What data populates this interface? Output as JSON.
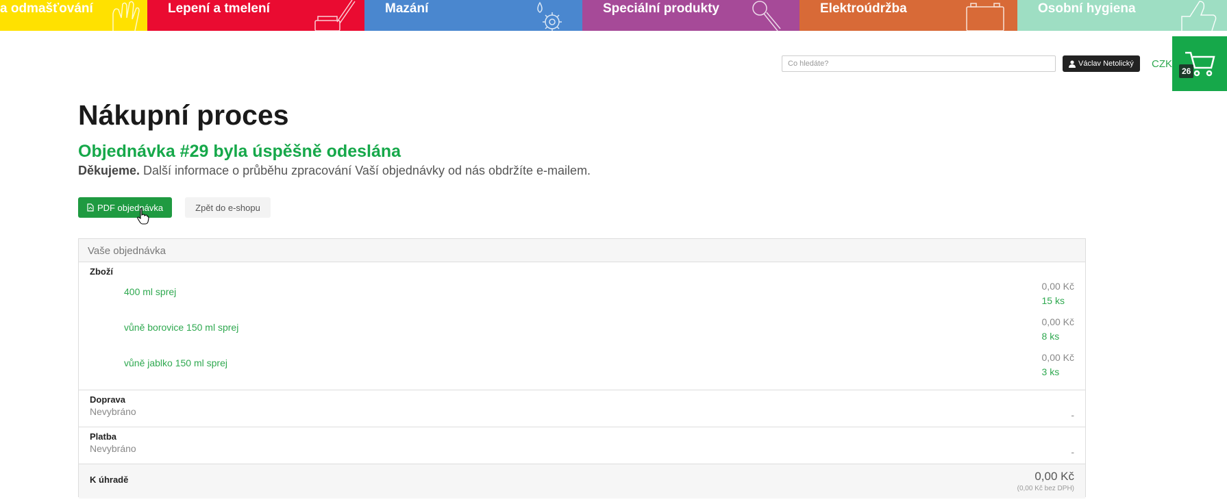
{
  "categories": [
    {
      "label": "a odmašťování",
      "color": "#ffe100"
    },
    {
      "label": "Lepení a tmelení",
      "color": "#ea0b31"
    },
    {
      "label": "Mazání",
      "color": "#4a87cf"
    },
    {
      "label": "Speciální produkty",
      "color": "#a64a98"
    },
    {
      "label": "Elektroúdržba",
      "color": "#d86a37"
    },
    {
      "label": "Osobní hygiena",
      "color": "#9edec3"
    }
  ],
  "header": {
    "search_placeholder": "Co hledáte?",
    "user_name": "Václav Netolický",
    "currency": "CZK",
    "cart_count": "26"
  },
  "main": {
    "title": "Nákupní proces",
    "success": "Objednávka #29 byla úspěšně odeslána",
    "thanks_bold": "Děkujeme.",
    "thanks_text": " Další informace o průběhu zpracování Vaší objednávky od nás obdržíte e-mailem.",
    "pdf_label": "PDF objednávka",
    "back_label": "Zpět do e-shopu"
  },
  "order": {
    "heading": "Vaše objednávka",
    "goods_label": "Zboží",
    "items": [
      {
        "name": "400 ml sprej",
        "price": "0,00 Kč",
        "qty": "15 ks"
      },
      {
        "name": "vůně borovice 150 ml sprej",
        "price": "0,00 Kč",
        "qty": "8 ks"
      },
      {
        "name": "vůně jablko 150 ml sprej",
        "price": "0,00 Kč",
        "qty": "3 ks"
      }
    ],
    "shipping_label": "Doprava",
    "shipping_value": "Nevybráno",
    "shipping_price": "-",
    "payment_label": "Platba",
    "payment_value": "Nevybráno",
    "payment_price": "-",
    "total_label": "K úhradě",
    "total_value": "0,00 Kč",
    "total_sub": "(0,00 Kč bez DPH)"
  }
}
